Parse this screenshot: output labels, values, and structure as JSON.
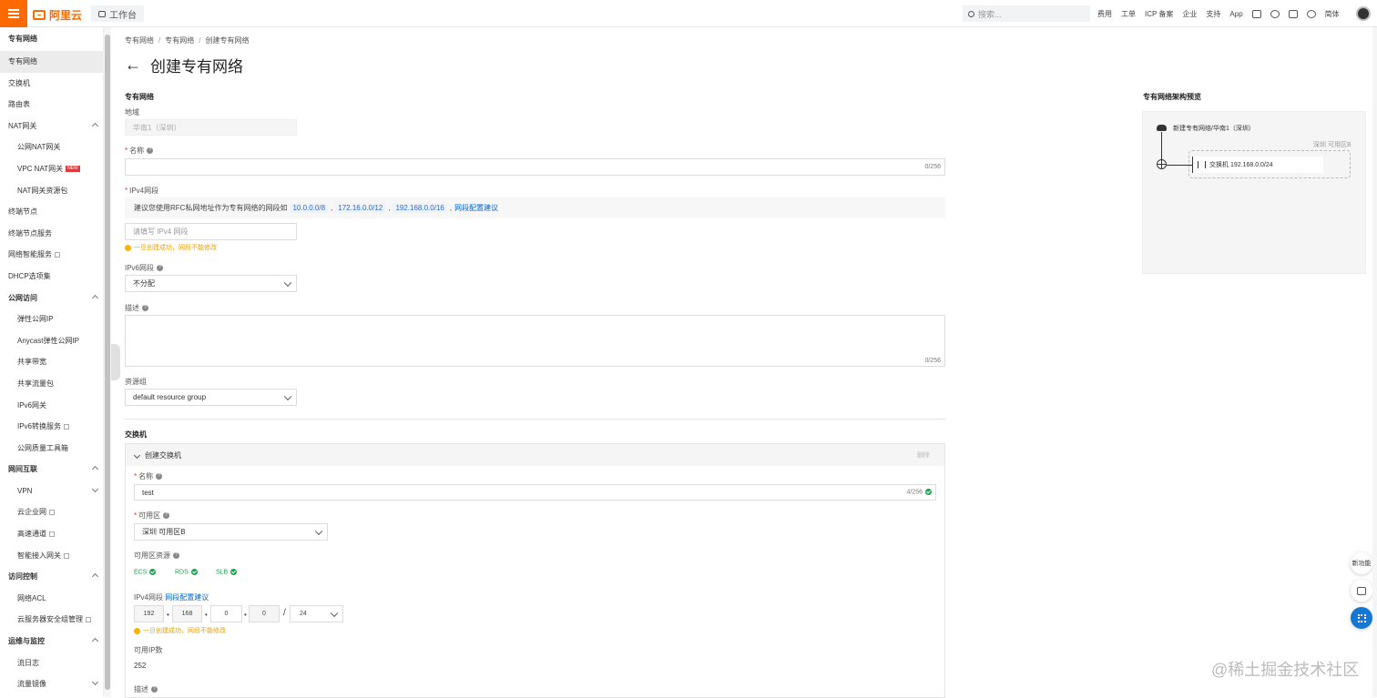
{
  "topbar": {
    "logo": "阿里云",
    "workbench": "工作台",
    "search_placeholder": "搜索...",
    "links": [
      "费用",
      "工单",
      "ICP 备案",
      "企业",
      "支持",
      "App"
    ],
    "lang": "简体"
  },
  "sidebar": {
    "title": "专有网络",
    "items": [
      {
        "label": "专有网络",
        "level": 0,
        "active": true
      },
      {
        "label": "交换机",
        "level": 0
      },
      {
        "label": "路由表",
        "level": 0
      },
      {
        "label": "NAT网关",
        "level": 0,
        "expandable": true
      },
      {
        "label": "公网NAT网关",
        "level": 1
      },
      {
        "label": "VPC NAT网关",
        "level": 1,
        "badge": "NEW"
      },
      {
        "label": "NAT网关资源包",
        "level": 1
      },
      {
        "label": "终端节点",
        "level": 0
      },
      {
        "label": "终端节点服务",
        "level": 0
      },
      {
        "label": "网络智能服务",
        "level": 0,
        "external": true
      },
      {
        "label": "DHCP选项集",
        "level": 0
      },
      {
        "label": "公网访问",
        "level": 0,
        "group": true,
        "expandable": true
      },
      {
        "label": "弹性公网IP",
        "level": 1
      },
      {
        "label": "Anycast弹性公网IP",
        "level": 1
      },
      {
        "label": "共享带宽",
        "level": 1
      },
      {
        "label": "共享流量包",
        "level": 1
      },
      {
        "label": "IPv6网关",
        "level": 1
      },
      {
        "label": "IPv6转换服务",
        "level": 1,
        "external": true
      },
      {
        "label": "公网质量工具箱",
        "level": 1
      },
      {
        "label": "网间互联",
        "level": 0,
        "group": true,
        "expandable": true
      },
      {
        "label": "VPN",
        "level": 1,
        "expandable_down": true
      },
      {
        "label": "云企业网",
        "level": 1,
        "external": true
      },
      {
        "label": "高速通道",
        "level": 1,
        "external": true
      },
      {
        "label": "智能接入网关",
        "level": 1,
        "external": true
      },
      {
        "label": "访问控制",
        "level": 0,
        "group": true,
        "expandable": true
      },
      {
        "label": "网络ACL",
        "level": 1
      },
      {
        "label": "云服务器安全组管理",
        "level": 1,
        "external": true
      },
      {
        "label": "运维与监控",
        "level": 0,
        "group": true,
        "expandable": true
      },
      {
        "label": "流日志",
        "level": 1
      },
      {
        "label": "流量镜像",
        "level": 1,
        "expandable_down": true
      }
    ]
  },
  "breadcrumb": [
    "专有网络",
    "专有网络",
    "创建专有网络"
  ],
  "page_title": "创建专有网络",
  "vpc_form": {
    "section_title": "专有网络",
    "region_label": "地域",
    "region_value": "华南1（深圳）",
    "name_label": "名称",
    "name_count": "0/256",
    "ipv4_label": "IPv4网段",
    "tip_prefix": "建议您使用RFC私网地址作为专有网络的网段如",
    "cidrs": [
      "10.0.0.0/8",
      "172.16.0.0/12",
      "192.168.0.0/16"
    ],
    "tip_link": "网段配置建议",
    "ipv4_placeholder": "请填写 IPv4 网段",
    "ipv4_warn": "一旦创建成功，网段不能修改",
    "ipv6_label": "IPv6网段",
    "ipv6_value": "不分配",
    "desc_label": "描述",
    "desc_count": "0/256",
    "rg_label": "资源组",
    "rg_value": "default resource group"
  },
  "vswitch_form": {
    "section_title": "交换机",
    "header": "创建交换机",
    "delete": "删除",
    "name_label": "名称",
    "name_value": "test",
    "name_count": "4/256",
    "zone_label": "可用区",
    "zone_value": "深圳 可用区B",
    "zone_res_label": "可用区资源",
    "resources": [
      "ECS",
      "RDS",
      "SLB"
    ],
    "ipv4_label": "IPv4网段",
    "ipv4_link": "网段配置建议",
    "octets": [
      "192",
      "168",
      "0",
      "0"
    ],
    "mask": "24",
    "ipv4_warn": "一旦创建成功，网段不能修改",
    "avail_ip_label": "可用IP数",
    "avail_ip_value": "252",
    "desc_label": "描述"
  },
  "preview": {
    "title": "专有网络架构预览",
    "vpc_label": "新建专有网络/华南1（深圳）",
    "zone_label": "深圳 可用区B",
    "switch_label": "交换机 192.168.0.0/24"
  },
  "float_buttons": [
    "新功能",
    "反馈"
  ],
  "watermark": "@稀土掘金技术社区",
  "colors": {
    "brand": "#ff6a00",
    "link": "#0064c8",
    "success": "#1aa34a",
    "warning": "#f5b400"
  }
}
